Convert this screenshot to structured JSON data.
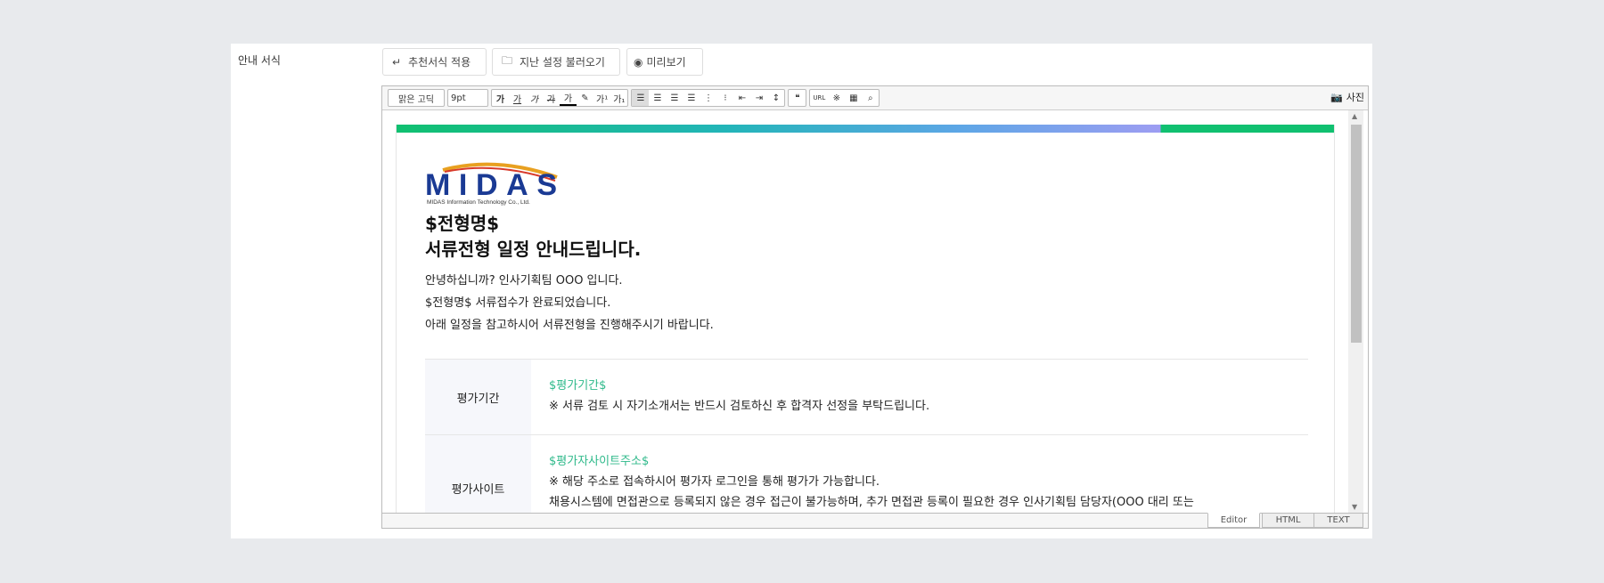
{
  "field_label": "안내 서식",
  "buttons": {
    "recommend": "추천서식 적용",
    "load_last": "지난 설정 불러오기",
    "preview": "미리보기"
  },
  "toolbar": {
    "font": "맑은 고딕",
    "size": "9pt",
    "bold": "가",
    "underline": "가",
    "italic": "가",
    "strike": "가",
    "color": "가",
    "sup": "가¹",
    "sub": "가₁",
    "quote": "❝",
    "url": "URL",
    "special": "※",
    "photo": "사진"
  },
  "doc": {
    "logo_text": "MIDAS",
    "logo_sub": "MIDAS Information Technology Co., Ltd.",
    "heading1": "$전형명$",
    "heading2": "서류전형 일정 안내드립니다.",
    "lines": [
      "안녕하십니까? 인사기획팀 OOO 입니다.",
      "$전형명$ 서류접수가 완료되었습니다.",
      "아래 일정을 참고하시어 서류전형을 진행해주시기 바랍니다."
    ],
    "rows": [
      {
        "label": "평가기간",
        "var": "$평가기간$",
        "text": [
          "※ 서류 검토 시 자기소개서는 반드시 검토하신 후 합격자 선정을 부탁드립니다."
        ]
      },
      {
        "label": "평가사이트",
        "var": "$평가자사이트주소$",
        "text": [
          "※ 해당 주소로 접속하시어 평가자 로그인을 통해 평가가 가능합니다.",
          "채용시스템에 면접관으로 등록되지 않은 경우 접근이 불가능하며, 추가 면접관 등록이 필요한 경우 인사기획팀 담당자(OOO 대리 또는"
        ]
      }
    ]
  },
  "tabs": [
    "Editor",
    "HTML",
    "TEXT"
  ],
  "colors": {
    "green": "#10c070",
    "var": "#2eb98a"
  }
}
